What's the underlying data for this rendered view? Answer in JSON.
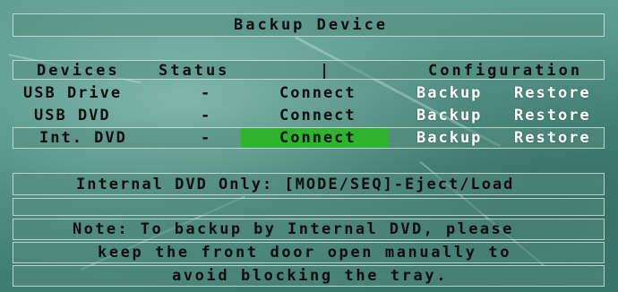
{
  "title": "Backup Device",
  "table": {
    "headers": {
      "devices": "Devices",
      "status": "Status",
      "separator": "|",
      "configuration": "Configuration"
    },
    "rows": [
      {
        "device": "USB Drive",
        "status": "-",
        "connect": "Connect",
        "backup": "Backup",
        "restore": "Restore"
      },
      {
        "device": "USB DVD",
        "status": "-",
        "connect": "Connect",
        "backup": "Backup",
        "restore": "Restore"
      },
      {
        "device": "Int. DVD",
        "status": "-",
        "connect": "Connect",
        "backup": "Backup",
        "restore": "Restore"
      }
    ],
    "selected_row": 2
  },
  "internal_dvd_hint": "Internal DVD Only: [MODE/SEQ]-Eject/Load",
  "note": {
    "line1": "Note: To backup by Internal DVD, please",
    "line2": "keep the front door open manually to",
    "line3": "avoid blocking the tray."
  },
  "colors": {
    "highlight": "#2db32d",
    "action_text": "#ffffff",
    "label_text": "#0f0f0f"
  }
}
